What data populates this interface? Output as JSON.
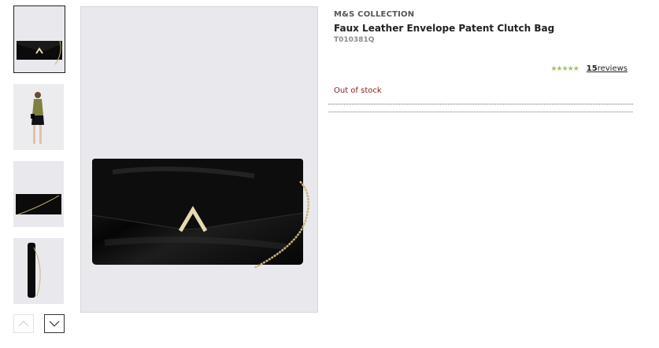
{
  "gallery": {
    "thumbnails": [
      {
        "alt": "bag-front",
        "selected": true
      },
      {
        "alt": "model-wearing-bag",
        "selected": false
      },
      {
        "alt": "bag-with-chain",
        "selected": false
      },
      {
        "alt": "bag-side",
        "selected": false
      }
    ],
    "nav": {
      "up_icon": "chevron-up-icon",
      "down_icon": "chevron-down-icon"
    }
  },
  "product": {
    "brand": "M&S COLLECTION",
    "title": "Faux Leather Envelope Patent Clutch Bag",
    "sku": "T010381Q",
    "rating": {
      "stars": "★★★★★",
      "count": "15",
      "label": "reviews",
      "star_color": "#9fc163"
    },
    "stock_status": "Out of stock",
    "stock_color": "#8b1a1a"
  }
}
